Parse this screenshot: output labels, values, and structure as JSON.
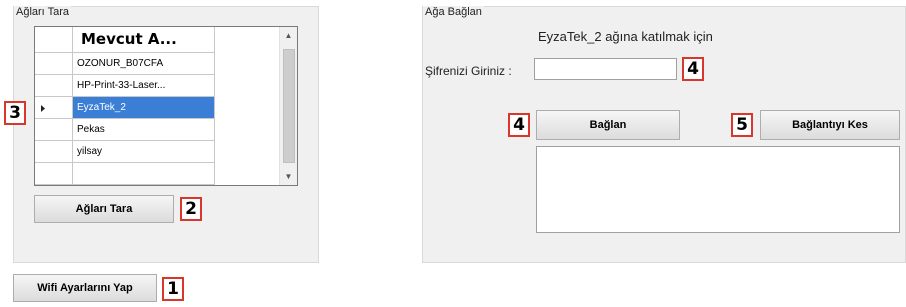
{
  "scan_group": {
    "title": "Ağları Tara",
    "grid": {
      "column_header": "Mevcut A...",
      "rows": [
        {
          "name": "OZONUR_B07CFA",
          "selected": false
        },
        {
          "name": "HP-Print-33-Laser...",
          "selected": false
        },
        {
          "name": "EyzaTek_2",
          "selected": true
        },
        {
          "name": "Pekas",
          "selected": false
        },
        {
          "name": "yilsay",
          "selected": false
        },
        {
          "name": "",
          "selected": false
        }
      ],
      "row_pointer_icon": "triangle-right-icon"
    },
    "scan_button_label": "Ağları Tara"
  },
  "connect_group": {
    "title": "Ağa Bağlan",
    "info_text": "EyzaTek_2  ağına katılmak için",
    "password_label": "Şifrenizi Giriniz :",
    "password_value": "",
    "connect_button_label": "Bağlan",
    "disconnect_button_label": "Bağlantıyı Kes",
    "status_text": ""
  },
  "wifi_settings_button_label": "Wifi Ayarlarını Yap",
  "badges": {
    "wifi_settings": "1",
    "scan": "2",
    "grid_row": "3",
    "password": "4",
    "connect": "4",
    "disconnect": "5"
  },
  "colors": {
    "selected_row": "#3b7ed6",
    "badge_border": "#d9372b",
    "group_background": "#f0f0f0"
  }
}
